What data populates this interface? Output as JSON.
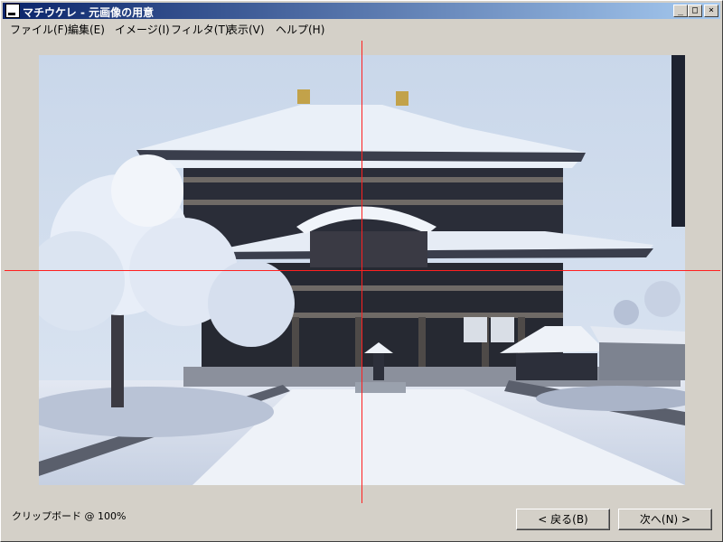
{
  "window": {
    "title": "マチウケレ - 元画像の用意",
    "controls": {
      "minimize": "_",
      "maximize": "□",
      "close": "×"
    }
  },
  "menu": [
    {
      "label": "ファイル(F)"
    },
    {
      "label": "編集(E)"
    },
    {
      "label": "イメージ(I)"
    },
    {
      "label": "フィルタ(T)"
    },
    {
      "label": "表示(V)"
    },
    {
      "label": "ヘルプ(H)"
    }
  ],
  "crosshair_color": "#ff2020",
  "status": {
    "text": "クリップボード @ 100%"
  },
  "buttons": {
    "back": "< 戻る(B)",
    "next": "次へ(N) >"
  }
}
